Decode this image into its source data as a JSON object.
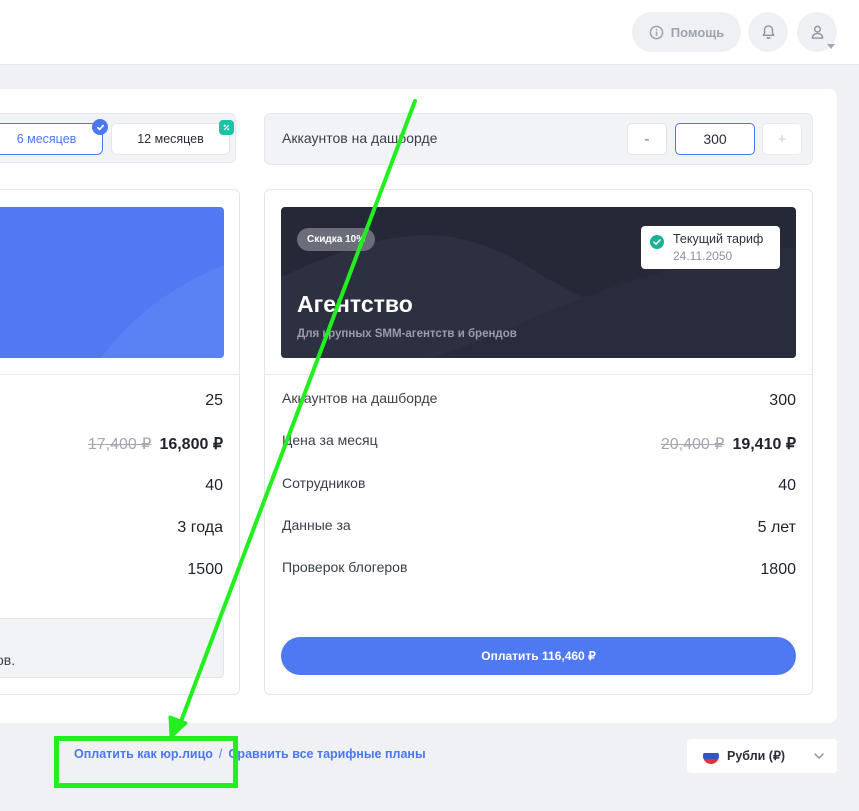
{
  "header": {
    "help_label": "Помощь",
    "icons": [
      "info-icon",
      "bell-icon",
      "user-icon",
      "chevron-down-icon"
    ]
  },
  "period": {
    "options": [
      {
        "label": "6 месяцев",
        "selected": true,
        "badge_icon": "check-icon"
      },
      {
        "label": "12 месяцев",
        "selected": false,
        "badge_icon": "percent-icon"
      }
    ]
  },
  "accounts": {
    "label": "Аккаунтов на дашборде",
    "minus_label": "-",
    "value": "300",
    "plus_label": "+"
  },
  "plans": [
    {
      "rows": [
        {
          "value": "25"
        },
        {
          "old_price": "17,400 ₽",
          "new_price": "16,800 ₽"
        },
        {
          "value": "40"
        },
        {
          "value": "3 года"
        },
        {
          "value": "1500"
        }
      ],
      "note": "нтов."
    },
    {
      "discount": "Скидка 10%",
      "current_label": "Текущий тариф",
      "current_date": "24.11.2050",
      "name": "Агентство",
      "description": "Для крупных SMM-агентств и брендов",
      "rows": [
        {
          "label": "Аккаунтов на дашборде",
          "value": "300"
        },
        {
          "label": "Цена за месяц",
          "old_price": "20,400 ₽",
          "new_price": "19,410 ₽"
        },
        {
          "label": "Сотрудников",
          "value": "40"
        },
        {
          "label": "Данные за",
          "value": "5 лет"
        },
        {
          "label": "Проверок блогеров",
          "value": "1800"
        }
      ],
      "pay_label": "Оплатить 116,460 ₽"
    }
  ],
  "footer": {
    "legal_link": "Оплатить как юр.лицо",
    "separator": "/",
    "compare_link": "Сравнить все тарифные планы",
    "currency": "Рубли (₽)"
  },
  "colors": {
    "accent": "#4f79f1",
    "dark_banner": "#252837",
    "annotation": "#22f01e"
  }
}
